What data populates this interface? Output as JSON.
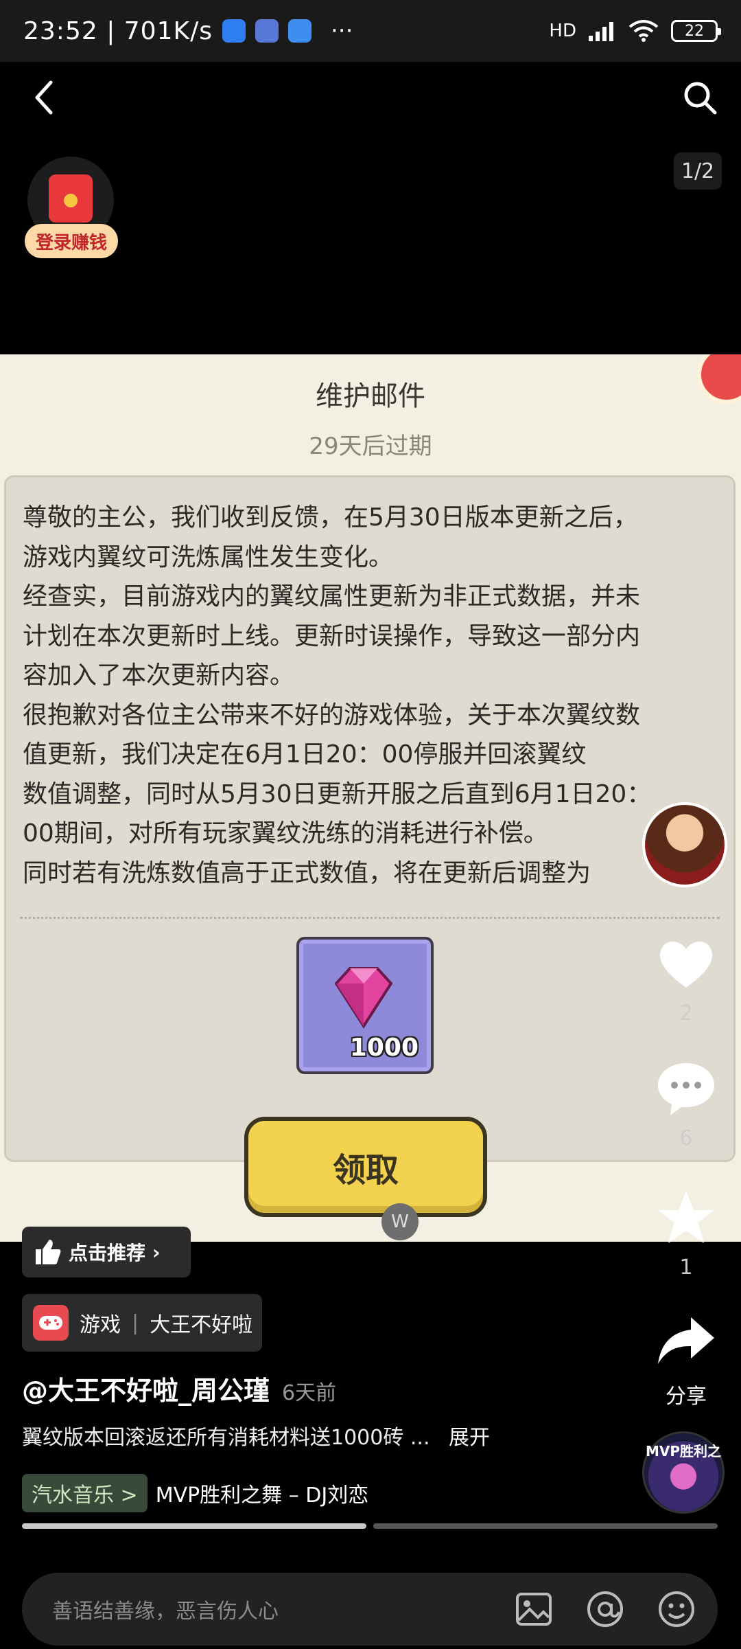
{
  "status": {
    "time": "23:52 | 701K/s",
    "more": "···",
    "network": "HD",
    "battery": "22"
  },
  "nav": {
    "page_counter": "1/2"
  },
  "promo": {
    "label": "登录赚钱"
  },
  "mail": {
    "title": "维护邮件",
    "expire": "29天后过期",
    "body": "尊敬的主公，我们收到反馈，在5月30日版本更新之后，\n游戏内翼纹可洗炼属性发生变化。\n经查实，目前游戏内的翼纹属性更新为非正式数据，并未\n计划在本次更新时上线。更新时误操作，导致这一部分内\n容加入了本次更新内容。\n很抱歉对各位主公带来不好的游戏体验，关于本次翼纹数\n值更新，我们决定在6月1日20：00停服并回滚翼纹\n数值调整，同时从5月30日更新开服之后直到6月1日20：\n00期间，对所有玩家翼纹洗练的消耗进行补偿。\n同时若有洗炼数值高于正式数值，将在更新后调整为",
    "reward_count": "1000",
    "claim_label": "领取",
    "watermark": "W"
  },
  "actions": {
    "like_count": "2",
    "comment_count": "6",
    "favorite_count": "1",
    "share_label": "分享"
  },
  "video": {
    "recommend_label": "点击推荐",
    "category": "游戏",
    "channel": "大王不好啦",
    "author": "@大王不好啦_周公瑾",
    "posted": "6天前",
    "description": "翼纹版本回滚返还所有消耗材料送1000砖 ...",
    "expand": "展开",
    "music_tag": "汽水音乐 >",
    "music_title": "MVP胜利之舞 – DJ刘恋",
    "disc_label": "MVP胜利之"
  },
  "comment": {
    "placeholder": "善语结善缘，恶言伤人心"
  },
  "colors": {
    "accent": "#e8383c",
    "panel": "#f4efe3",
    "button": "#f2d24f"
  }
}
